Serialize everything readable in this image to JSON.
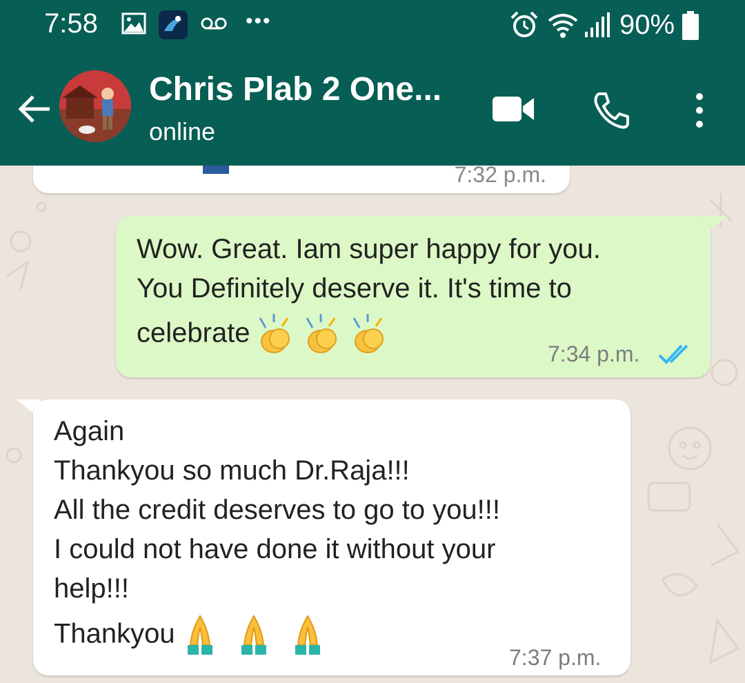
{
  "status_bar": {
    "time": "7:58",
    "battery": "90%",
    "icons": [
      "gallery-icon",
      "app-icon",
      "voicemail-icon",
      "more-dots-icon",
      "alarm-icon",
      "wifi-icon",
      "signal-icon",
      "battery-icon"
    ]
  },
  "header": {
    "contact_name": "Chris Plab 2 One...",
    "contact_status": "online",
    "icons": [
      "back-arrow-icon",
      "video-call-icon",
      "phone-icon",
      "menu-icon"
    ],
    "color": "#075e54"
  },
  "messages": [
    {
      "direction": "incoming",
      "partial": true,
      "time": "7:32 p.m."
    },
    {
      "direction": "outgoing",
      "lines": [
        "Wow. Great. Iam super happy for you.",
        "You Definitely deserve it. It's time to",
        "celebrate"
      ],
      "emoji": "clapping-hands-icon",
      "emoji_count": 3,
      "time": "7:34 p.m.",
      "read_receipt": "double-tick-icon",
      "bubble_color": "#dcf8c6"
    },
    {
      "direction": "incoming",
      "lines": [
        "Again",
        "Thankyou so much Dr.Raja!!!",
        "All the credit deserves to go to you!!!",
        "I could not have done it without your",
        "help!!!",
        "Thankyou"
      ],
      "emoji": "folded-hands-icon",
      "emoji_count": 3,
      "time": "7:37 p.m."
    }
  ],
  "colors": {
    "chat_background": "#ece5dd",
    "tick_blue": "#34b7f1"
  }
}
